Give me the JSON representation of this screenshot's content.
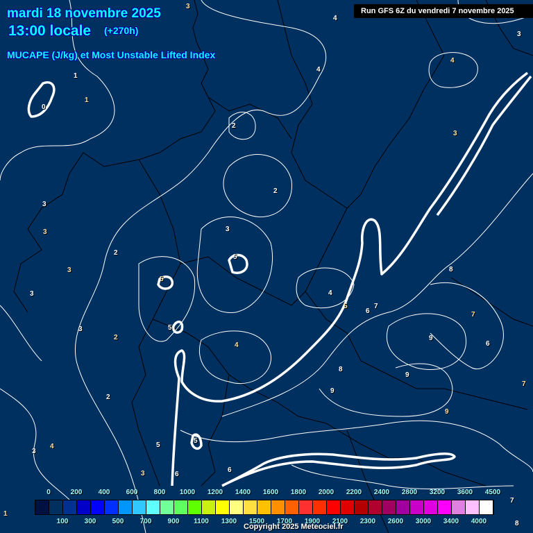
{
  "header": {
    "date": "mardi 18 novembre 2025",
    "time": "13:00 locale",
    "lead": "(+270h)",
    "parameter": "MUCAPE (J/kg) et Most Unstable Lifted Index",
    "run": "Run GFS 6Z du vendredi 7 novembre 2025"
  },
  "footer": {
    "copyright": "Copyright 2025 Meteociel.fr"
  },
  "legend": {
    "colors": [
      "#001040",
      "#003060",
      "#003090",
      "#0000c8",
      "#0000ff",
      "#0030ff",
      "#0096ff",
      "#30c8ff",
      "#60ffff",
      "#70ff98",
      "#60ff60",
      "#60ff00",
      "#c8f010",
      "#ffff00",
      "#ffff80",
      "#ffe040",
      "#ffc000",
      "#ff9000",
      "#ff6000",
      "#ff3030",
      "#ff3000",
      "#ff0000",
      "#e00000",
      "#b40000",
      "#b00030",
      "#a00060",
      "#a000a0",
      "#c800c8",
      "#e000e0",
      "#ff00ff",
      "#e080e0",
      "#ffc0ff",
      "#ffffff"
    ],
    "labels": [
      "0",
      "100",
      "200",
      "300",
      "400",
      "500",
      "600",
      "700",
      "800",
      "900",
      "1000",
      "1100",
      "1200",
      "1300",
      "1400",
      "1500",
      "1600",
      "1700",
      "1800",
      "1900",
      "2000",
      "2100",
      "2200",
      "2300",
      "2400",
      "2600",
      "2800",
      "3000",
      "3200",
      "3400",
      "3600",
      "4000",
      "4500"
    ]
  },
  "contour_labels": [
    "3",
    "4",
    "3",
    "4",
    "4",
    "1",
    "1",
    "0",
    "2",
    "3",
    "2",
    "3",
    "3",
    "3",
    "2",
    "3",
    "5",
    "8",
    "5",
    "3",
    "4",
    "5",
    "6",
    "7",
    "7",
    "5",
    "3",
    "2",
    "9",
    "6",
    "4",
    "8",
    "9",
    "7",
    "9",
    "2",
    "9",
    "5",
    "5",
    "4",
    "3",
    "6",
    "3",
    "6",
    "7",
    "1",
    "8"
  ]
}
